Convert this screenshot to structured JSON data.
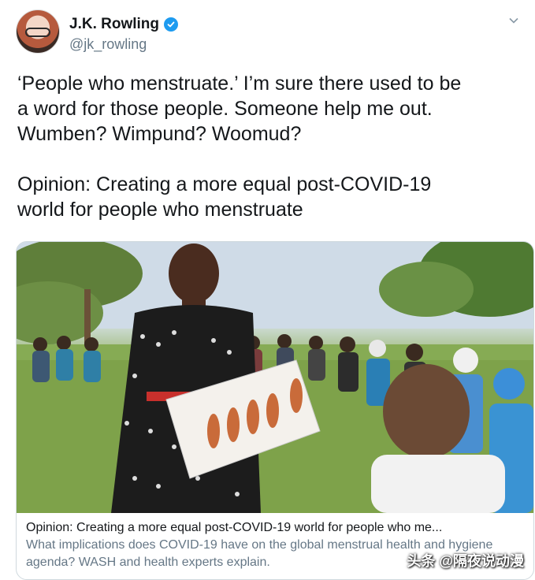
{
  "author": {
    "name": "J.K. Rowling",
    "handle": "@jk_rowling",
    "avatar_icon": "profile-avatar",
    "verified_icon": "verified-badge-icon",
    "verified_color": "#1d9bf0"
  },
  "tweet": {
    "lines": [
      "‘People who menstruate.’ I’m sure there used to be",
      "a word for those people. Someone help me out.",
      "Wumben? Wimpund? Woomud?"
    ],
    "quote_lines": [
      "Opinion: Creating a more equal post-COVID-19",
      "world for people who menstruate"
    ]
  },
  "card": {
    "image_icon": "article-photo",
    "title": "Opinion: Creating a more equal post-COVID-19 world for people who me...",
    "description": "What implications does COVID-19 have on the global menstrual health and hygiene agenda? WASH and health experts explain."
  },
  "watermark": "头条 @隔夜说动漫",
  "colors": {
    "text": "#14171a",
    "secondary": "#657786",
    "border": "#cfd9de"
  }
}
